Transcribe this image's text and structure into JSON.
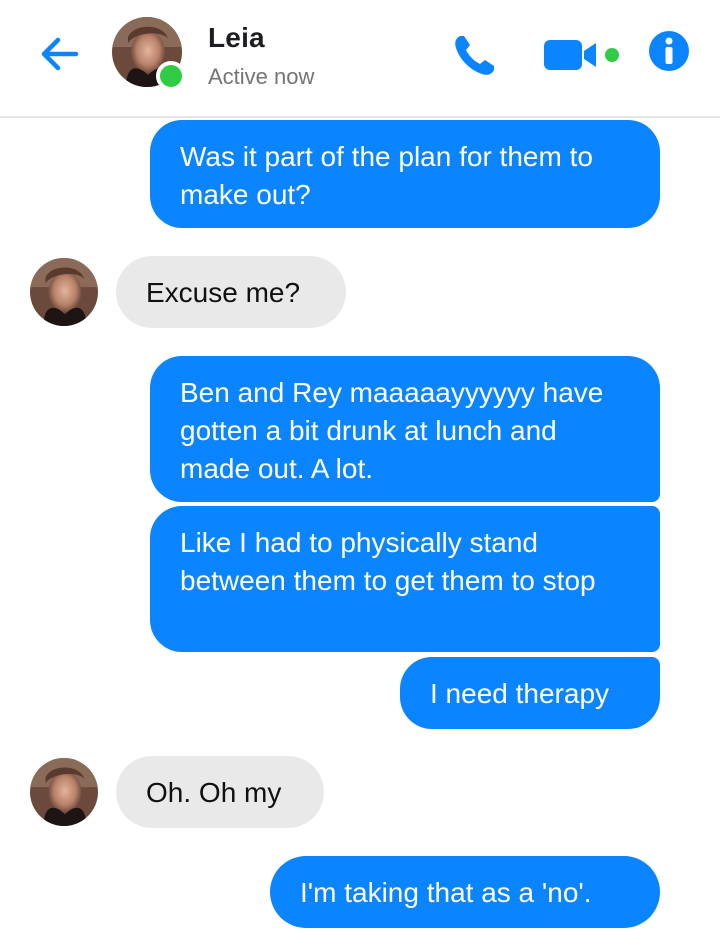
{
  "header": {
    "contact_name": "Leia",
    "status": "Active now",
    "icons": {
      "back": "back-arrow-icon",
      "phone": "phone-icon",
      "video": "video-camera-icon",
      "info": "info-icon"
    },
    "online": true
  },
  "colors": {
    "accent": "#0b84ff",
    "received_bubble": "#e9e9e9",
    "online_green": "#31cc46"
  },
  "messages": [
    {
      "from": "me",
      "text": "Was it part of the plan for them to make out?"
    },
    {
      "from": "Leia",
      "text": "Excuse me?"
    },
    {
      "from": "me",
      "text": "Ben and Rey maaaaayyyyyy have gotten a bit drunk at lunch and made out. A lot."
    },
    {
      "from": "me",
      "text": "Like I had to physically stand between them to get them to stop"
    },
    {
      "from": "me",
      "text": "I need therapy"
    },
    {
      "from": "Leia",
      "text": "Oh. Oh my"
    },
    {
      "from": "me",
      "text": "I'm taking that as a 'no'."
    }
  ]
}
